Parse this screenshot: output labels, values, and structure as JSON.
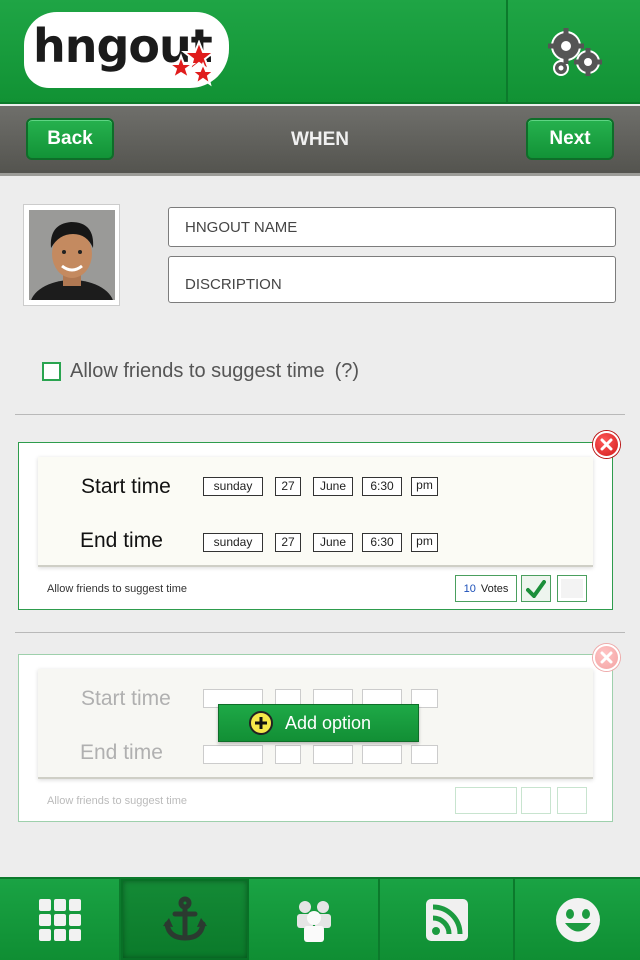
{
  "header": {
    "logo_text": "hngout",
    "settings_icon": "gear-icon"
  },
  "navbar": {
    "back_label": "Back",
    "title": "WHEN",
    "next_label": "Next"
  },
  "form": {
    "name_placeholder": "HNGOUT NAME",
    "description_placeholder": "DISCRIPTION",
    "allow_label": "Allow friends to suggest time",
    "allow_help": "(?)",
    "allow_checked": false
  },
  "options": [
    {
      "start_label": "Start time",
      "end_label": "End time",
      "start": {
        "day": "sunday",
        "date": "27",
        "month": "June",
        "time": "6:30",
        "ampm": "pm"
      },
      "end": {
        "day": "sunday",
        "date": "27",
        "month": "June",
        "time": "6:30",
        "ampm": "pm"
      },
      "footer": "Allow friends to suggest time",
      "votes_count": "10",
      "votes_label": "Votes"
    },
    {
      "start_label": "Start time",
      "end_label": "End time",
      "footer": "Allow friends to suggest time"
    }
  ],
  "add_option_label": "Add option",
  "tabs": [
    {
      "icon": "grid-icon"
    },
    {
      "icon": "anchor-icon",
      "active": true
    },
    {
      "icon": "people-icon"
    },
    {
      "icon": "rss-icon"
    },
    {
      "icon": "smiley-icon"
    }
  ],
  "colors": {
    "brand_green": "#159a3b",
    "nav_gray": "#5f5f5a",
    "close_red": "#d11a1a"
  }
}
